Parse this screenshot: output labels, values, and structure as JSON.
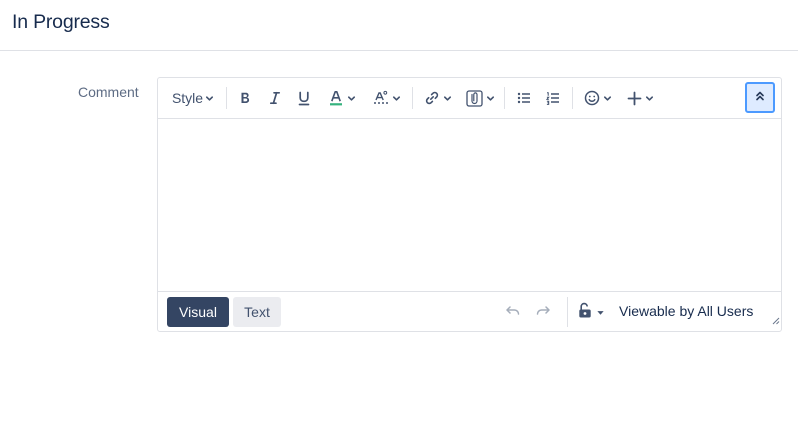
{
  "header": {
    "title": "In Progress"
  },
  "comment": {
    "label": "Comment",
    "toolbar": {
      "style_label": "Style",
      "buttons": [
        {
          "icon": "bold-icon",
          "label": "B"
        },
        {
          "icon": "italic-icon",
          "label": "I"
        },
        {
          "icon": "underline-icon",
          "label": "U"
        },
        {
          "icon": "text-color-icon",
          "label": "A"
        },
        {
          "icon": "text-effects-icon"
        },
        {
          "icon": "link-icon"
        },
        {
          "icon": "attachment-icon"
        },
        {
          "icon": "bullet-list-icon"
        },
        {
          "icon": "numbered-list-icon"
        },
        {
          "icon": "emoji-icon"
        },
        {
          "icon": "insert-plus-icon"
        },
        {
          "icon": "collapse-toolbar-icon"
        }
      ],
      "colors": {
        "text_color_underline": "#36b37e",
        "active_border": "#4c9aff"
      }
    },
    "body_text": "",
    "footer": {
      "mode_visual": "Visual",
      "mode_text": "Text",
      "active_mode": "Visual",
      "visibility": "Viewable by All Users"
    }
  }
}
